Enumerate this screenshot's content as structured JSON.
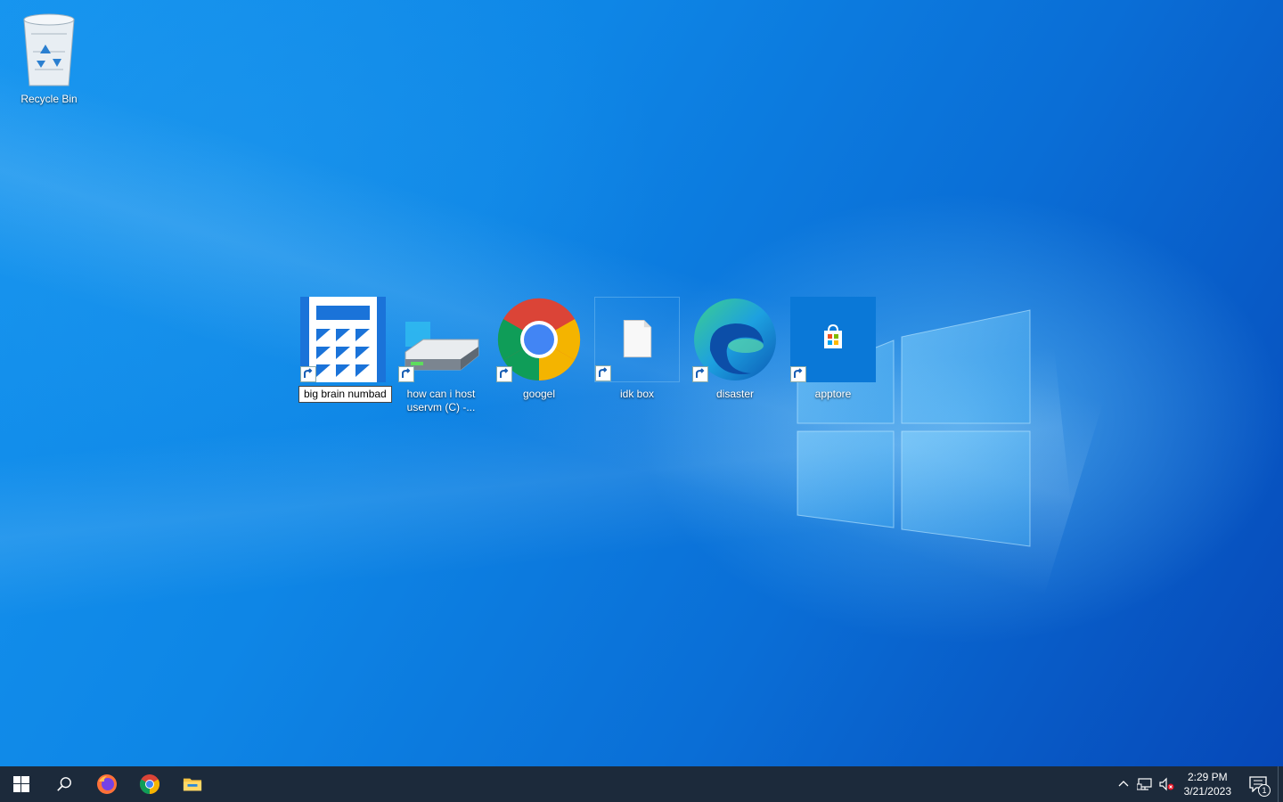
{
  "desktop": {
    "icons": [
      {
        "label": "Recycle Bin"
      },
      {
        "label": "big brain numbad",
        "renaming": true
      },
      {
        "label": "how can i host uservm (C) -..."
      },
      {
        "label": "googel"
      },
      {
        "label": "idk box"
      },
      {
        "label": "disaster"
      },
      {
        "label": "apptore"
      }
    ]
  },
  "taskbar": {
    "pinned": [
      "start-icon",
      "search-icon",
      "firefox-icon",
      "chrome-icon",
      "file-explorer-icon"
    ],
    "clock": {
      "time": "2:29 PM",
      "date": "3/21/2023"
    },
    "notification_count": "1"
  },
  "colors": {
    "wallpaper": "#0b74d8",
    "taskbar": "#1c2a3b"
  }
}
